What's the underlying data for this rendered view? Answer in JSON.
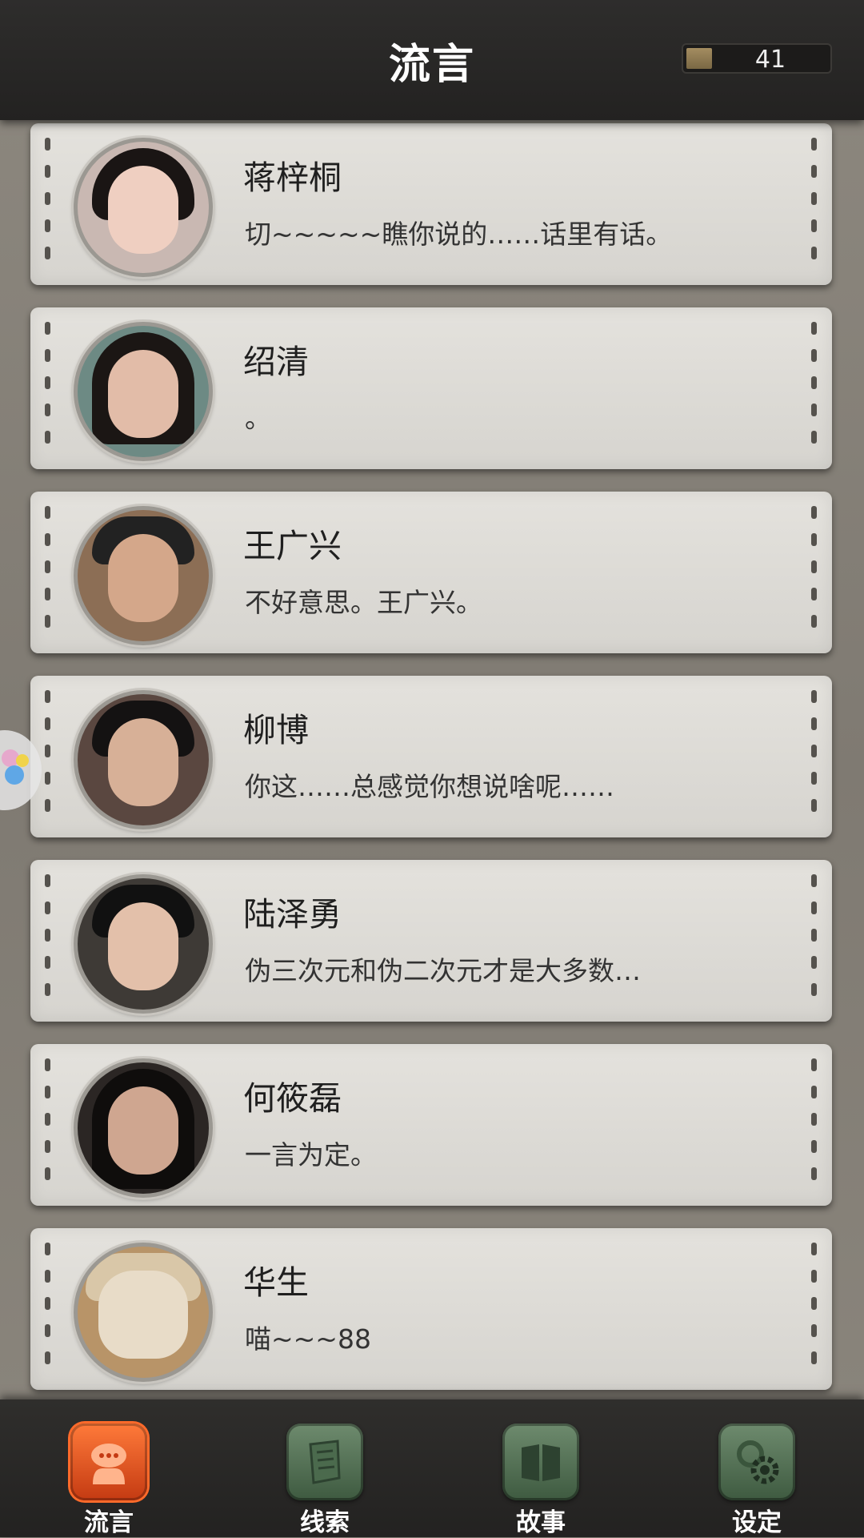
{
  "header": {
    "title": "流言",
    "counter": "41"
  },
  "contacts": [
    {
      "name": "蒋梓桐",
      "message": "切~~~~~瞧你说的……话里有话。"
    },
    {
      "name": "绍清",
      "message": "。"
    },
    {
      "name": "王广兴",
      "message": "不好意思。王广兴。"
    },
    {
      "name": "柳博",
      "message": "你这……总感觉你想说啥呢……"
    },
    {
      "name": "陆泽勇",
      "message": "伪三次元和伪二次元才是大多数…"
    },
    {
      "name": "何筱磊",
      "message": "一言为定。"
    },
    {
      "name": "华生",
      "message": "喵~~~88"
    }
  ],
  "tabs": [
    {
      "label": "流言",
      "icon": "chat-bubble-icon",
      "active": true
    },
    {
      "label": "线索",
      "icon": "note-paper-icon"
    },
    {
      "label": "故事",
      "icon": "book-icon"
    },
    {
      "label": "设定",
      "icon": "gear-icon"
    }
  ],
  "colors": {
    "accent": "#e8531c",
    "tab_green": "#4e6b50",
    "header": "#2a2928"
  }
}
